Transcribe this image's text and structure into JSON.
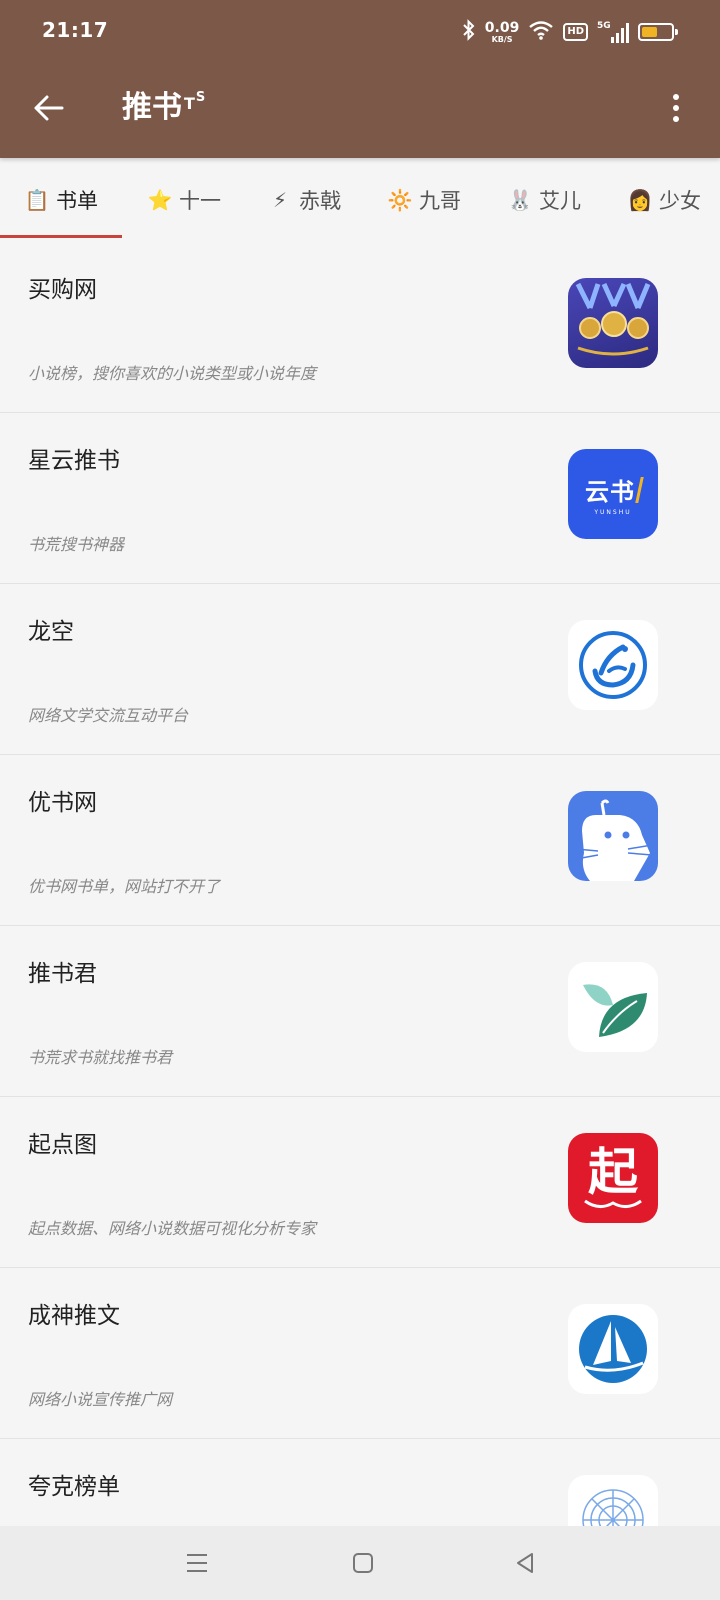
{
  "status_bar": {
    "time": "21:17",
    "net_speed_value": "0.09",
    "net_speed_unit": "KB/S",
    "hd_label": "HD",
    "network_label": "5G",
    "battery_level": 0.55,
    "icons": [
      "bluetooth-icon",
      "wifi-icon",
      "signal-icon",
      "battery-icon"
    ]
  },
  "app_bar": {
    "title": "推书",
    "title_suffix": "T",
    "title_suffix_sup": "S",
    "back_icon": "arrow-left-icon",
    "more_icon": "more-vertical-icon",
    "background_color": "#7c5848"
  },
  "tabs": [
    {
      "icon": "📋",
      "icon_name": "clipboard-icon",
      "label": "书单",
      "active": true
    },
    {
      "icon": "⭐",
      "icon_name": "star-icon",
      "label": "十一",
      "active": false
    },
    {
      "icon": "⚡",
      "icon_name": "lightning-icon",
      "label": "赤戟",
      "active": false
    },
    {
      "icon": "🔆",
      "icon_name": "sun-icon",
      "label": "九哥",
      "active": false
    },
    {
      "icon": "🐰",
      "icon_name": "rabbit-icon",
      "label": "艾儿",
      "active": false
    },
    {
      "icon": "👩",
      "icon_name": "girl-icon",
      "label": "少女",
      "active": false
    }
  ],
  "list": [
    {
      "name": "买购网",
      "desc": "小说榜，搜你喜欢的小说类型或小说年度",
      "icon": "medals-icon",
      "icon_text": ""
    },
    {
      "name": "星云推书",
      "desc": "书荒搜书神器",
      "icon": "yunshu-logo-icon",
      "icon_text": "云书",
      "icon_subtext": "YUNSHU"
    },
    {
      "name": "龙空",
      "desc": "网络文学交流互动平台",
      "icon": "longkong-logo-icon",
      "icon_text": ""
    },
    {
      "name": "优书网",
      "desc": "优书网书单，网站打不开了",
      "icon": "cat-logo-icon",
      "icon_text": ""
    },
    {
      "name": "推书君",
      "desc": "书荒求书就找推书君",
      "icon": "leaf-logo-icon",
      "icon_text": ""
    },
    {
      "name": "起点图",
      "desc": "起点数据、网络小说数据可视化分析专家",
      "icon": "qidian-logo-icon",
      "icon_text": "起"
    },
    {
      "name": "成神推文",
      "desc": "网络小说宣传推广网",
      "icon": "sailboat-logo-icon",
      "icon_text": ""
    },
    {
      "name": "夸克榜单",
      "desc": "",
      "icon": "quark-flower-icon",
      "icon_text": ""
    }
  ],
  "nav_bar": {
    "icons": [
      "menu-icon",
      "home-square-icon",
      "back-triangle-icon"
    ]
  },
  "colors": {
    "accent": "#c9433d",
    "header": "#7c5848",
    "list_bg": "#f5f5f5"
  }
}
